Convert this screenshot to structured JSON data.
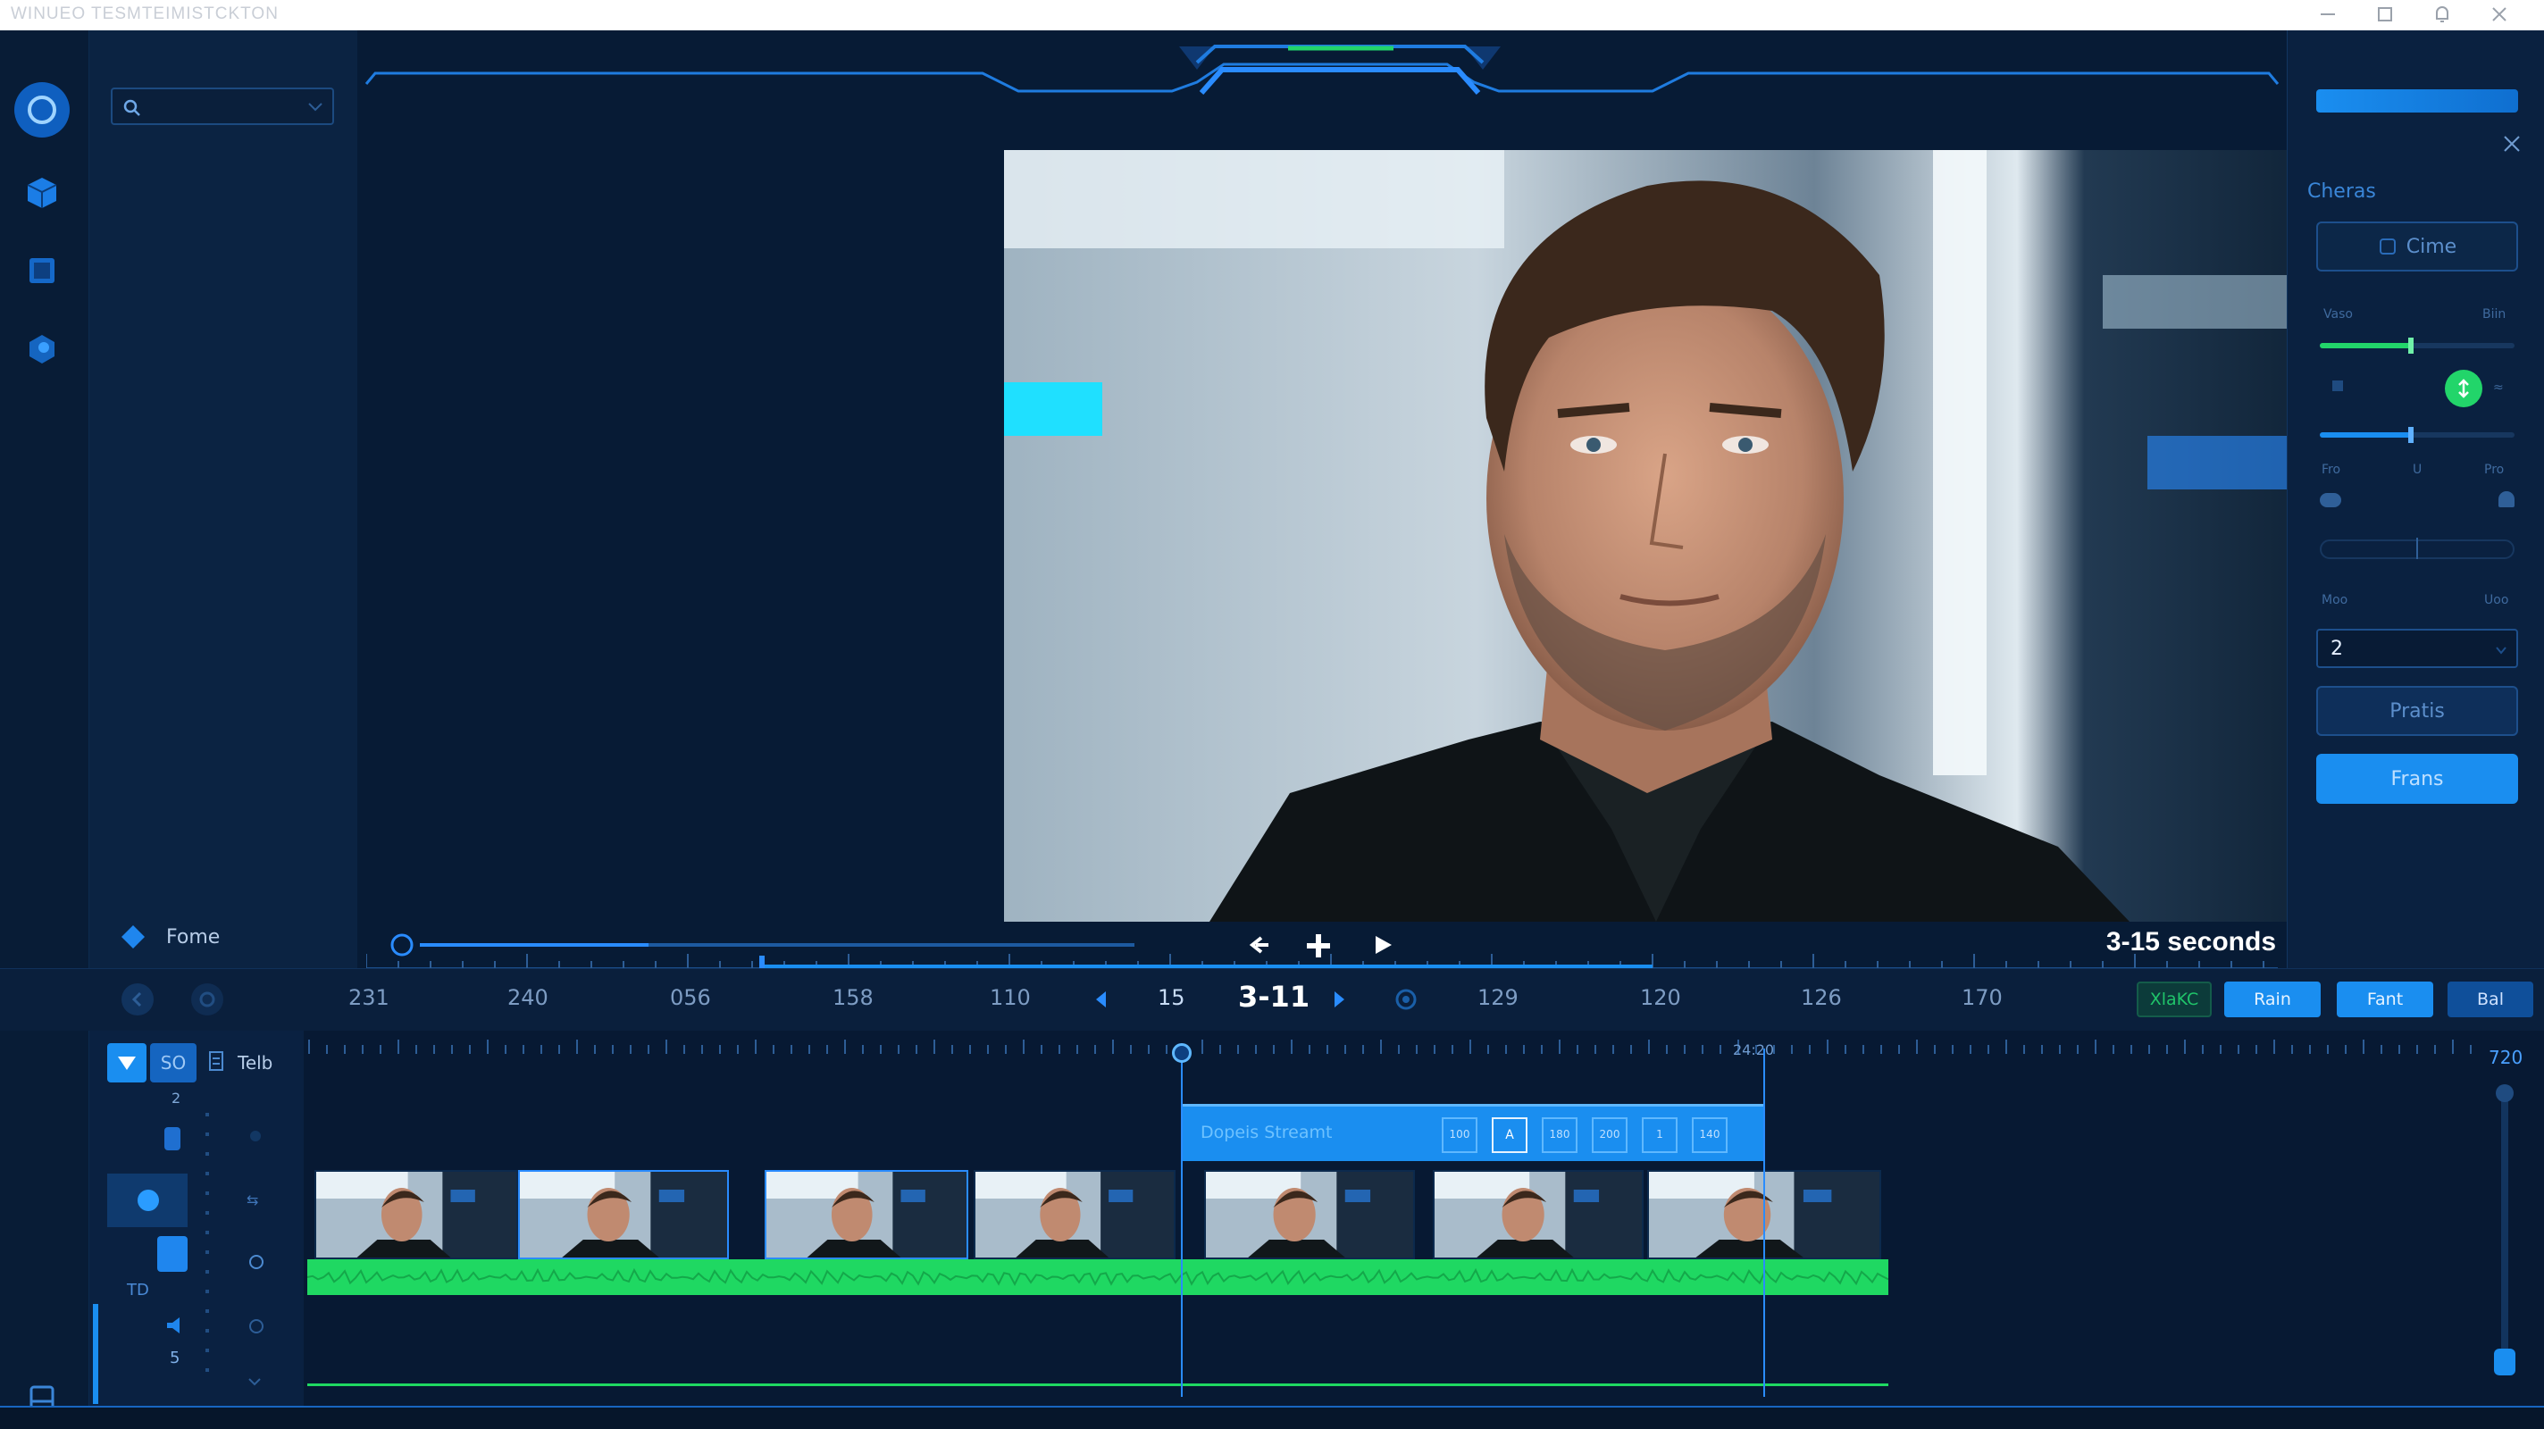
{
  "window": {
    "title": "WINUEO  TESMTEIMISTCKTON",
    "minimize_icon": "minimize-icon",
    "maximize_icon": "maximize-icon",
    "notification_icon": "bell-icon",
    "close_icon": "close-icon"
  },
  "rail": {
    "items": [
      "record-icon",
      "cube-icon",
      "square-icon",
      "shape-icon"
    ],
    "bottom_icon": "panel-icon"
  },
  "media_panel": {
    "search_placeholder": "",
    "home_label": "Fome"
  },
  "viewer": {
    "duration_label": "3-15 seconds",
    "scrub_progress": 0.32,
    "accent": "#1a8ef0"
  },
  "inspector": {
    "section_title": "Cheras",
    "cube_button": "Cime",
    "labels_row1": [
      "Vaso",
      "Biin"
    ],
    "labels_row2": [
      "Fro",
      "U",
      "Pro"
    ],
    "labels_row3": [
      "Moo",
      "Uoo"
    ],
    "slider1_value": 0.47,
    "slider2_value": 0.47,
    "select_value": "2",
    "outline_button": "Pratis",
    "primary_button": "Frans",
    "toggle_color": "#22d56a"
  },
  "transport": {
    "ticks": [
      "231",
      "240",
      "056",
      "158",
      "110",
      "15",
      "3-11",
      "129",
      "120",
      "126",
      "170"
    ],
    "current": "3-11",
    "buttons": [
      "XlaKC",
      "Rain",
      "Fant",
      "Bal"
    ],
    "accent_green": "#20c46a"
  },
  "timeline": {
    "label_so": "SO",
    "label_tells": "Telb",
    "num_2": "2",
    "label_td": "TD",
    "num_5": "5",
    "ruler_end": "720",
    "marker_label": "24:20",
    "clip_label": "Dopeis Streamt",
    "clip_actions": [
      "100",
      "A",
      "180",
      "200",
      "1",
      "140"
    ],
    "audio_color": "#1fd862"
  }
}
